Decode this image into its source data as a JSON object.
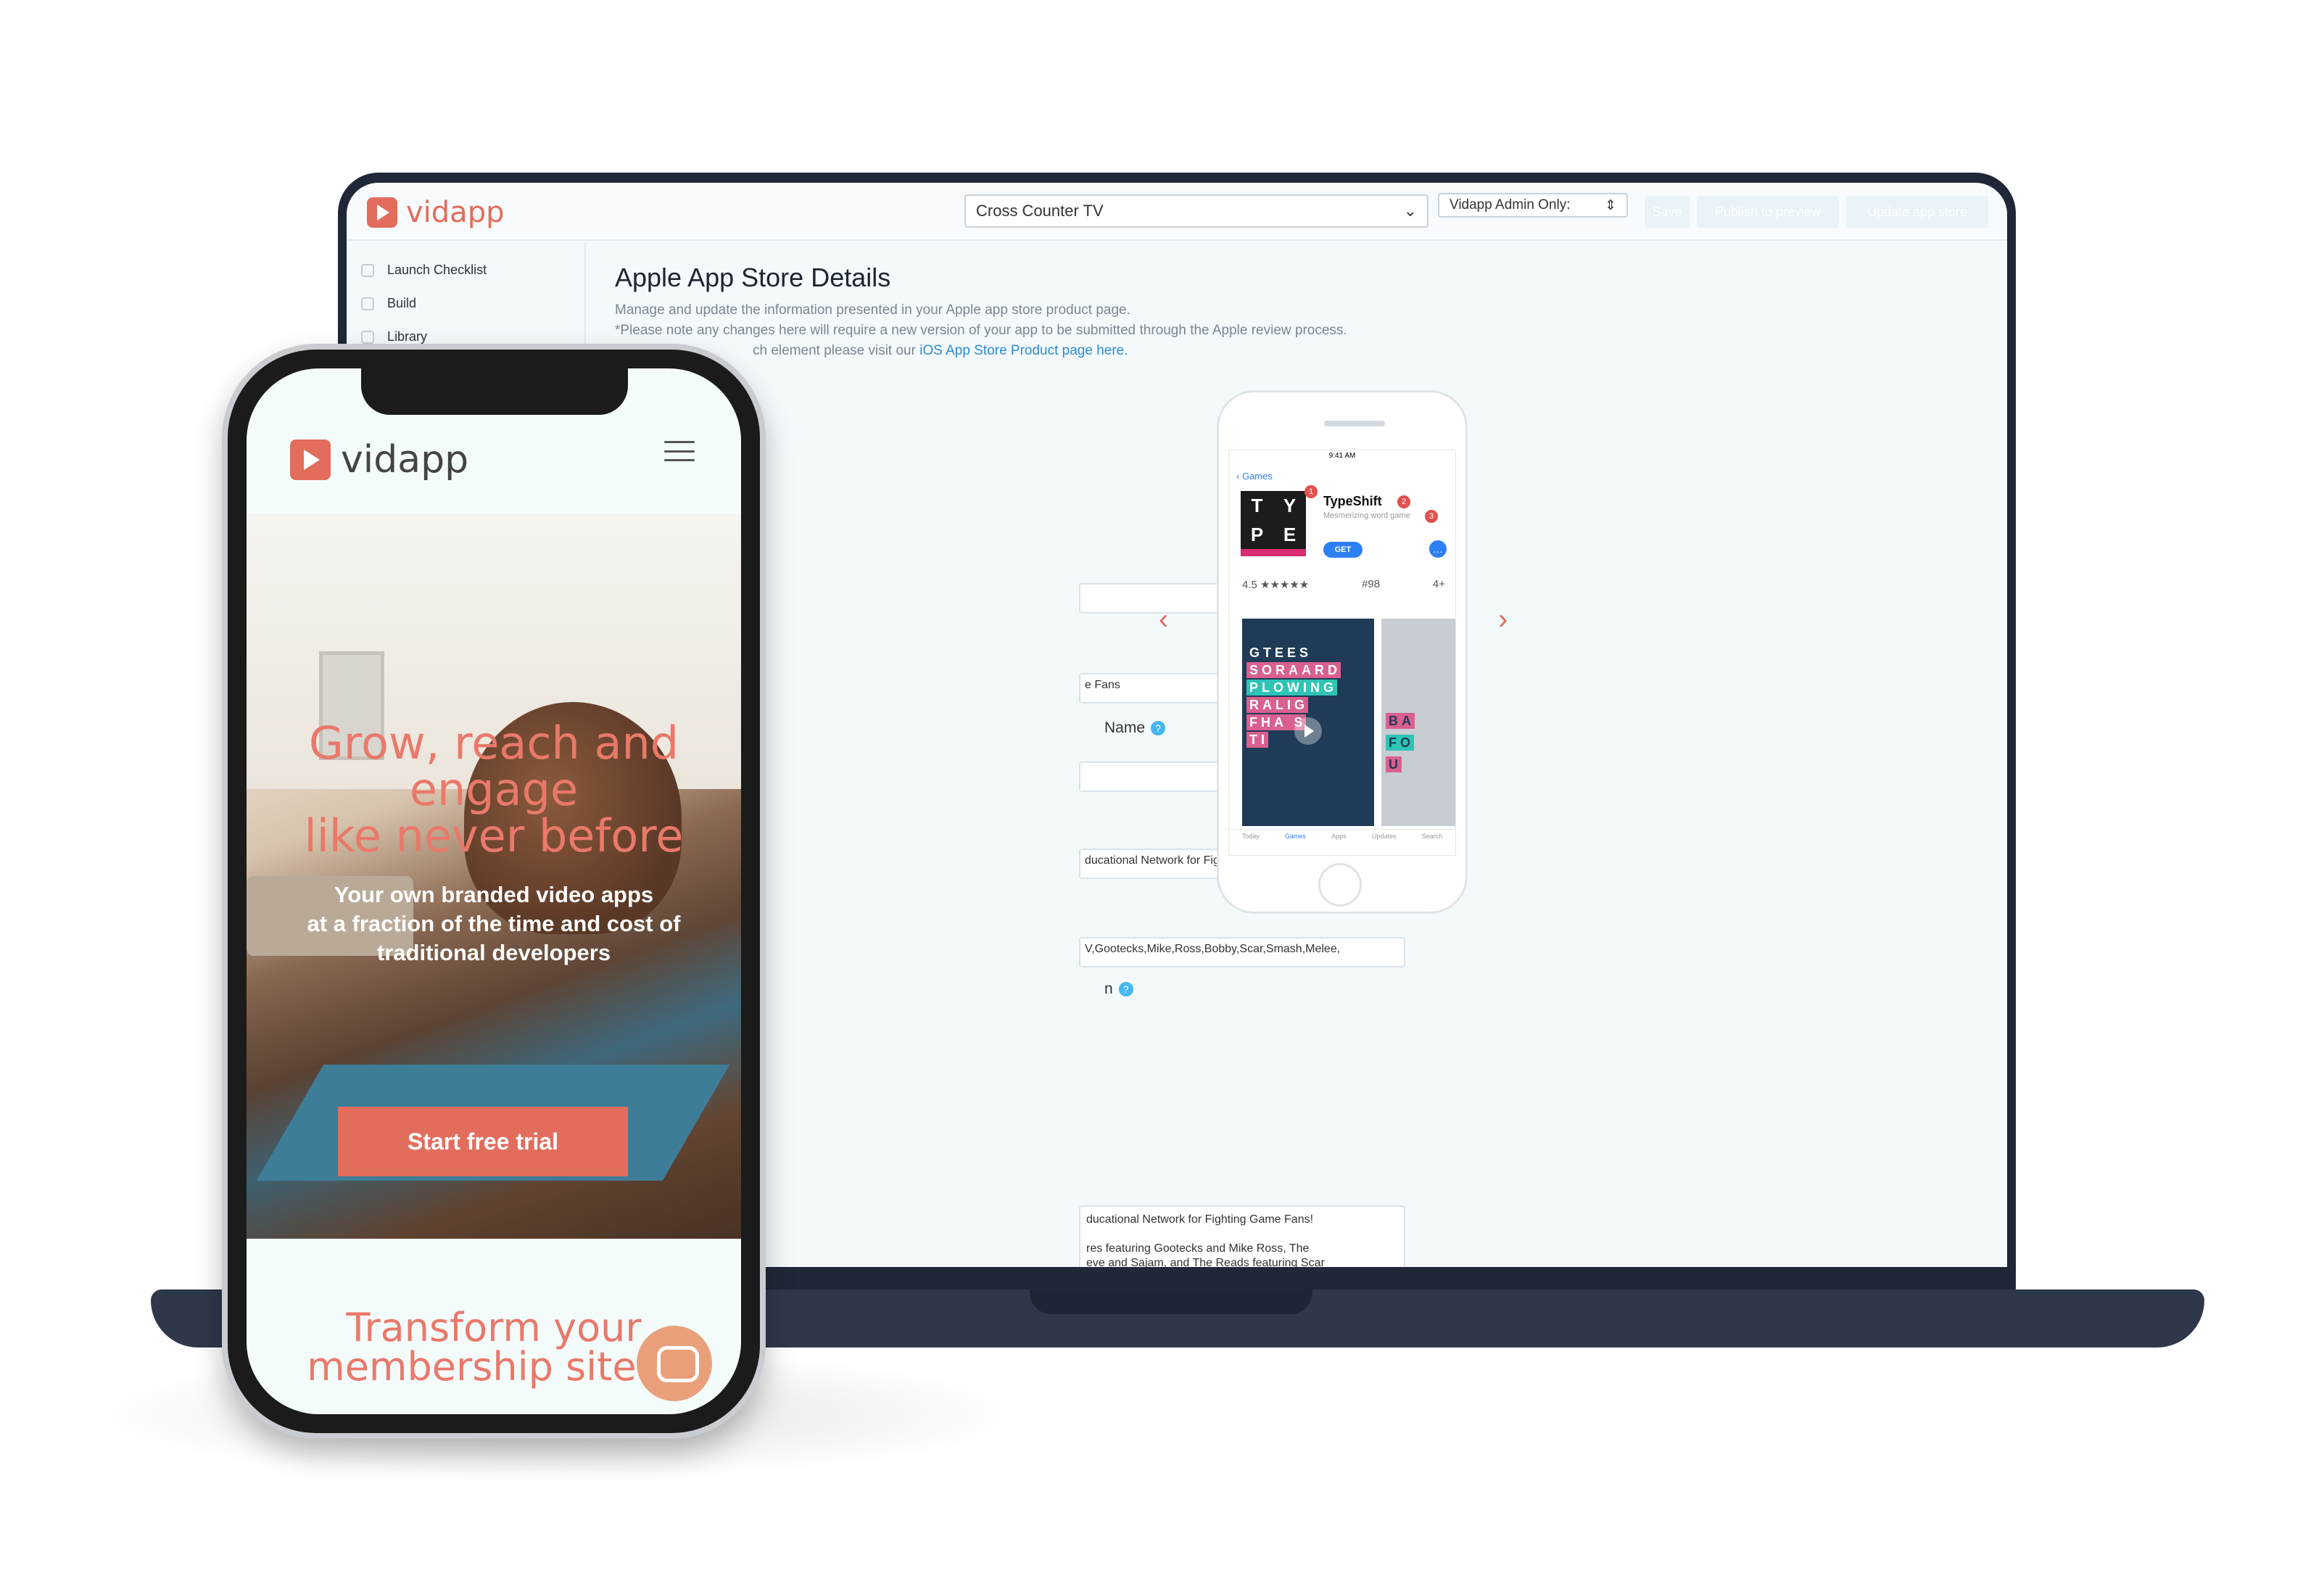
{
  "laptop": {
    "brand": "vidapp",
    "app_select": "Cross Counter TV",
    "admin_select": "Vidapp Admin Only:",
    "buttons": [
      "Save",
      "Publish to preview",
      "Update app store"
    ],
    "sidebar": [
      {
        "label": "Launch Checklist",
        "icon": "checklist-icon"
      },
      {
        "label": "Build",
        "icon": "wrench-icon"
      },
      {
        "label": "Library",
        "icon": "library-icon"
      }
    ],
    "title": "Apple App Store Details",
    "desc1": "Manage and update the information presented in your Apple app store product page.",
    "desc2": "*Please note any changes here will require a new version of your app to be submitted through the Apple review process.",
    "desc3": "ch element please visit our ",
    "desc3_link": "iOS App Store Product page here.",
    "fields": {
      "f1": "",
      "f2": "e Fans",
      "label_name": "Name",
      "f3": "",
      "f4": "ducational Network for Fighting Game Fans!",
      "f5": "V,Gootecks,Mike,Ross,Bobby,Scar,Smash,Melee,",
      "label_desc": "n",
      "textarea": "ducational Network for Fighting Game Fans!\n\nres featuring Gootecks and Mike Ross, The\neve and Sajam, and The Reads featuring Scar\nsed monthly all showcasing surprise special\nryone else with a subscription of only $5.99 to\necial bonus content, training videos and receive\nghting games like Street Fighter V, Smash Melee,\nte, Injustice 2, Tekken and more. Become the\nwith some of the top pros, players, hosts,"
    },
    "preview": {
      "status_time": "9:41 AM",
      "back": "Games",
      "app_name": "TypeShift",
      "app_sub": "Mesmerizing word game",
      "get": "GET",
      "rating": "4.5 ★★★★★",
      "rank": "#98",
      "age": "4+",
      "icon_letters": [
        "T",
        "Y",
        "P",
        "E"
      ],
      "shot_rows": [
        "GTEES",
        "SORAARD",
        "PLOWING",
        "RALIG",
        "FHA S",
        "TI"
      ],
      "shot2_rows": [
        "BA",
        "FO",
        "U"
      ],
      "tabs": [
        "Today",
        "Games",
        "Apps",
        "Updates",
        "Search"
      ],
      "badges": [
        "1",
        "2",
        "3"
      ]
    }
  },
  "phone": {
    "brand": "vidapp",
    "hero_title_1": "Grow, reach and",
    "hero_title_2": "engage",
    "hero_title_3": "like never before",
    "hero_sub_1": "Your own branded video apps",
    "hero_sub_2": "at a fraction of the time and cost of",
    "hero_sub_3": "traditional developers",
    "cta": "Start free trial",
    "section_1": "Transform your",
    "section_2": "membership site w"
  },
  "colors": {
    "accent": "#e26d5c",
    "link": "#2c8bd1",
    "ios_blue": "#2c7ff5"
  }
}
